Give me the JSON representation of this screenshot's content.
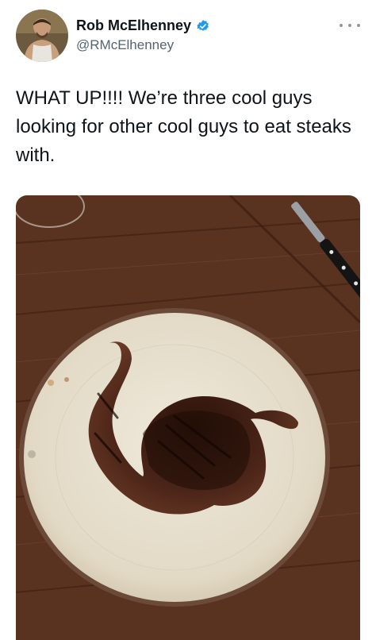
{
  "author": {
    "display_name": "Rob McElhenney",
    "handle": "@RMcElhenney",
    "verified": true
  },
  "tweet": {
    "text": "WHAT UP!!!! We’re three cool guys looking for other cool guys to eat steaks with."
  },
  "icons": {
    "verified": "verified-badge-icon",
    "more": "more-options-icon"
  },
  "colors": {
    "verified_blue": "#1d9bf0",
    "handle_gray": "#536471",
    "table_wood": "#5a3220",
    "plate": "#e9e2d2",
    "plate_rim": "#6b4a3a",
    "steak": "#4a2418"
  }
}
